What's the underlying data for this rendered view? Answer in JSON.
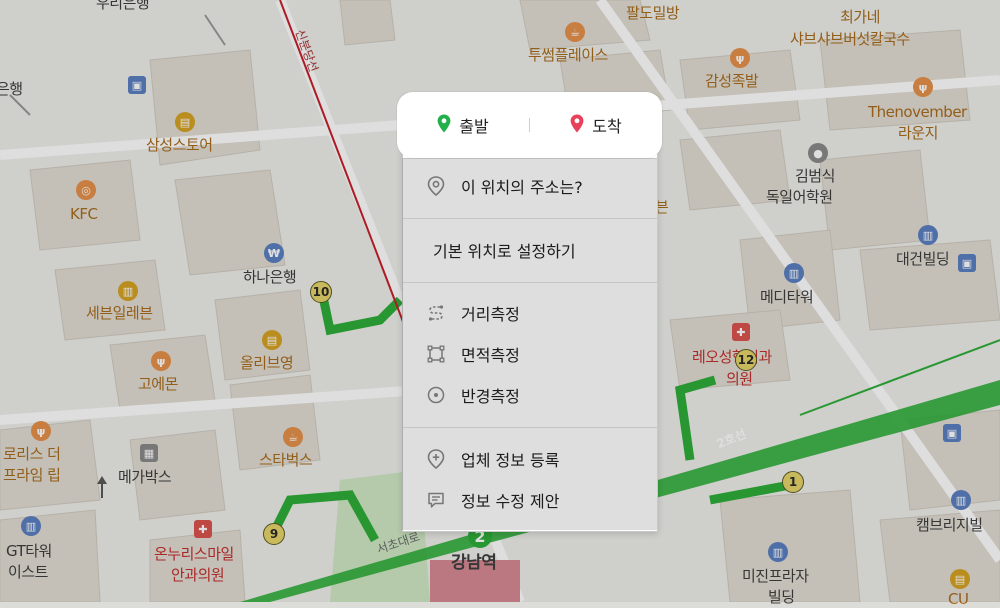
{
  "route": {
    "start_label": "출발",
    "end_label": "도착",
    "start_color": "#22b04b",
    "end_color": "#e8405a"
  },
  "menu": {
    "address_label": "이 위치의 주소는?",
    "default_location_label": "기본 위치로 설정하기",
    "distance_label": "거리측정",
    "area_label": "면적측정",
    "radius_label": "반경측정",
    "register_label": "업체 정보 등록",
    "suggest_label": "정보 수정 제안"
  },
  "map": {
    "subway_line_label": "신분당선",
    "line2_label": "2호선",
    "road_label": "서초대로",
    "station_name": "강남역",
    "line2_color": "#2fae3a",
    "shinbundang_color": "#c8202a",
    "places": {
      "woori_bank": "우리은행",
      "bank_partial": "은행",
      "samsung_store": "삼성스토어",
      "kfc": "KFC",
      "hana_bank": "하나은행",
      "seven_eleven": "세븐일레븐",
      "olive_young": "올리브영",
      "goemon": "고에몬",
      "lorise_line1": "로리스 더",
      "lorise_line2": "프라임 립",
      "starbucks": "스타벅스",
      "megabox": "메가박스",
      "gt_tower_line1": "GT타워",
      "gt_tower_line2": "이스트",
      "onnuri_line1": "온누리스마일",
      "onnuri_line2": "안과의원",
      "paldo": "팔도밀방",
      "twosome": "투썸플레이스",
      "gamseong": "감성족발",
      "choiga_line1": "최가네",
      "choiga_line2": "샤브샤브버섯칼국수",
      "thenovember_line1": "Thenovember",
      "thenovember_line2": "라운지",
      "kim_line1": "김범식",
      "kim_line2": "독일어학원",
      "daegun": "대건빌딩",
      "media": "메디타워",
      "reo_line1": "레오성형외과",
      "reo_line2": "의원",
      "cambridge": "캠브리지빌",
      "mijin_line1": "미진프라자",
      "mijin_line2": "빌딩",
      "cu": "CU",
      "bun_partial": "븐"
    },
    "exits": [
      "10",
      "12",
      "9",
      "1"
    ],
    "station_badge": "2"
  }
}
